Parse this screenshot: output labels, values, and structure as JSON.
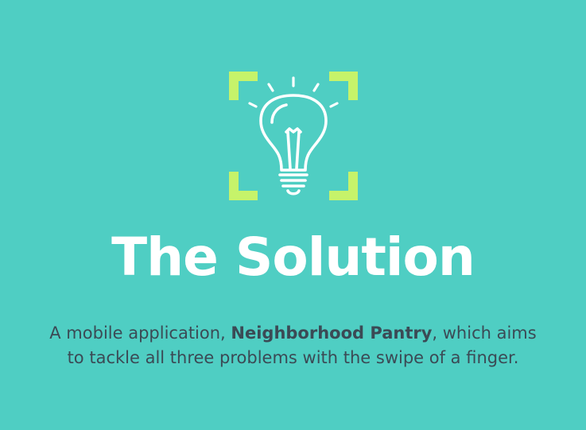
{
  "slide": {
    "background_color": "#4fcec3",
    "icon": {
      "name": "lightbulb-icon",
      "frame_color": "#c6f36a",
      "bulb_color": "#ffffff"
    },
    "title": "The Solution",
    "description": {
      "prefix": "A mobile application, ",
      "app_name": "Neighborhood Pantry",
      "suffix": ", which aims to tackle all three problems with the swipe of a finger."
    }
  }
}
